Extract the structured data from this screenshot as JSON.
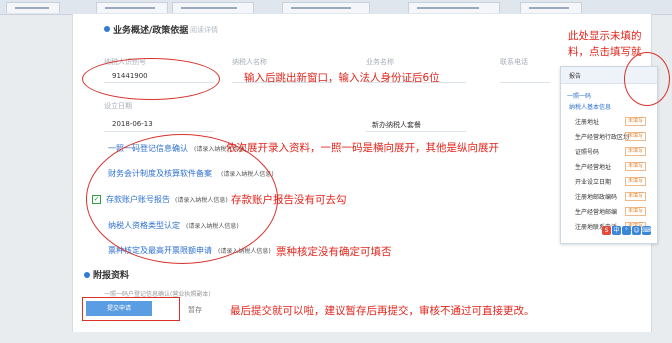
{
  "header": {
    "section1_title": "业务概述/政策依据",
    "section1_hint": "阅读详情",
    "section2_title": "附报资料"
  },
  "fields": {
    "row1": [
      {
        "label": "纳税人识别号",
        "value": "91441900"
      },
      {
        "label": "纳税人名称",
        "value": ""
      },
      {
        "label": "业务名称",
        "value": ""
      },
      {
        "label": "联系电话",
        "value": ""
      }
    ],
    "row2": [
      {
        "label": "设立日期",
        "value": "2018-06-13"
      },
      {
        "label": "",
        "value": "新办纳税人套餐"
      }
    ]
  },
  "links": [
    {
      "label": "一照一码登记信息确认",
      "sub": "(请录入纳税人信息)"
    },
    {
      "label": "财务会计制度及核算软件备案",
      "sub": "(请录入纳税人信息)"
    },
    {
      "label": "存款账户账号报告",
      "sub": "(请录入纳税人信息)"
    },
    {
      "label": "纳税人资格类型认定",
      "sub": "(请录入纳税人信息)"
    },
    {
      "label": "票种核定及最高开票限额申请",
      "sub": "(请录入纳税人信息)"
    }
  ],
  "attach_line": "一照一码户登记信息确认(营业执照副本)",
  "buttons": {
    "submit": "提交申请",
    "save": "暂存"
  },
  "popup": {
    "title": "报告",
    "group1": "一照一码",
    "group2": "纳税人基本信息",
    "rows": [
      "注册地址",
      "生产经营地行政区划",
      "证照号码",
      "生产经营地址",
      "开业设立日期",
      "注册地邮政编码",
      "生产经营地邮编",
      "注册地联系电话"
    ],
    "badge": "未填写"
  },
  "annotations": {
    "a1": "输入后跳出新窗口，输入法人身份证后6位",
    "a2": "依次展开录入资料，一照一码是横向展开，其他是纵向展开",
    "a3": "存款账户报告没有可去勾",
    "a4": "票种核定没有确定可填否",
    "a5": "最后提交就可以啦，建议暂存后再提交，审核不通过可直接更改。",
    "a6_line1": "此处显示未填的",
    "a6_line2": "料，点击填写就"
  },
  "colors": {
    "annotation": "#e2241b",
    "link": "#2d6fd1",
    "primary": "#5b9de3"
  }
}
